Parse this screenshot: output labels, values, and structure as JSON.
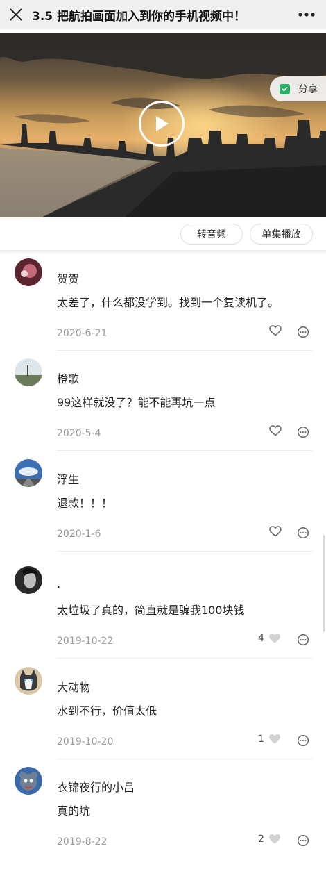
{
  "header": {
    "title": "3.5 把航拍画面加入到你的手机视频中！",
    "close_icon": "close-icon",
    "more_icon": "more-dots-icon"
  },
  "video": {
    "share_label": "分享",
    "play_icon": "play-icon"
  },
  "actions": {
    "to_audio": "转音频",
    "single_play": "单集播放"
  },
  "comments": [
    {
      "name": "贺贺",
      "text": "太差了，什么都没学到。找到一个复读机了。",
      "date": "2020-6-21",
      "likes": ""
    },
    {
      "name": "橙歌",
      "text": "99这样就没了？能不能再坑一点",
      "date": "2020-5-4",
      "likes": ""
    },
    {
      "name": "浮生",
      "text": "退款！！！",
      "date": "2020-1-6",
      "likes": ""
    },
    {
      "name": ".",
      "text": "太垃圾了真的，简直就是骗我100块钱",
      "date": "2019-10-22",
      "likes": "4"
    },
    {
      "name": "大动物",
      "text": "水到不行，价值太低",
      "date": "2019-10-20",
      "likes": "1"
    },
    {
      "name": "衣锦夜行的小吕",
      "text": "真的坑",
      "date": "2019-8-22",
      "likes": "2"
    }
  ],
  "colors": {
    "accent_green": "#2aae67",
    "meta_gray": "#9a9a9a"
  }
}
